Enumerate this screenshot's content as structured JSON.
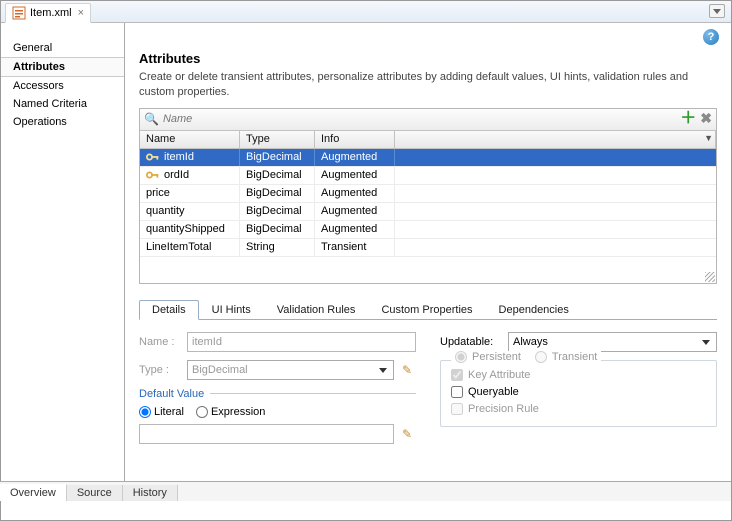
{
  "tab": {
    "filename": "Item.xml"
  },
  "sidebar": {
    "items": [
      {
        "label": "General"
      },
      {
        "label": "Attributes"
      },
      {
        "label": "Accessors"
      },
      {
        "label": "Named Criteria"
      },
      {
        "label": "Operations"
      }
    ],
    "selected": "Attributes"
  },
  "section": {
    "title": "Attributes",
    "desc": "Create or delete transient attributes, personalize attributes by adding default values, UI hints, validation rules and custom properties."
  },
  "grid": {
    "search_placeholder": "Name",
    "columns": {
      "name": "Name",
      "type": "Type",
      "info": "Info"
    },
    "rows": [
      {
        "key": true,
        "name": "itemId",
        "type": "BigDecimal",
        "info": "Augmented",
        "selected": true
      },
      {
        "key": true,
        "name": "ordId",
        "type": "BigDecimal",
        "info": "Augmented"
      },
      {
        "key": false,
        "name": "price",
        "type": "BigDecimal",
        "info": "Augmented"
      },
      {
        "key": false,
        "name": "quantity",
        "type": "BigDecimal",
        "info": "Augmented"
      },
      {
        "key": false,
        "name": "quantityShipped",
        "type": "BigDecimal",
        "info": "Augmented"
      },
      {
        "key": false,
        "name": "LineItemTotal",
        "type": "String",
        "info": "Transient"
      }
    ]
  },
  "detail_tabs": [
    {
      "label": "Details",
      "active": true
    },
    {
      "label": "UI Hints"
    },
    {
      "label": "Validation Rules"
    },
    {
      "label": "Custom Properties"
    },
    {
      "label": "Dependencies"
    }
  ],
  "details": {
    "name_label": "Name :",
    "name_value": "itemId",
    "type_label": "Type :",
    "type_value": "BigDecimal",
    "default_value_label": "Default Value",
    "literal_label": "Literal",
    "expression_label": "Expression",
    "updatable_label": "Updatable:",
    "updatable_value": "Always",
    "persistent_label": "Persistent",
    "transient_label": "Transient",
    "key_attr_label": "Key Attribute",
    "queryable_label": "Queryable",
    "precision_label": "Precision Rule"
  },
  "bottom_tabs": [
    {
      "label": "Overview",
      "active": true
    },
    {
      "label": "Source"
    },
    {
      "label": "History"
    }
  ]
}
